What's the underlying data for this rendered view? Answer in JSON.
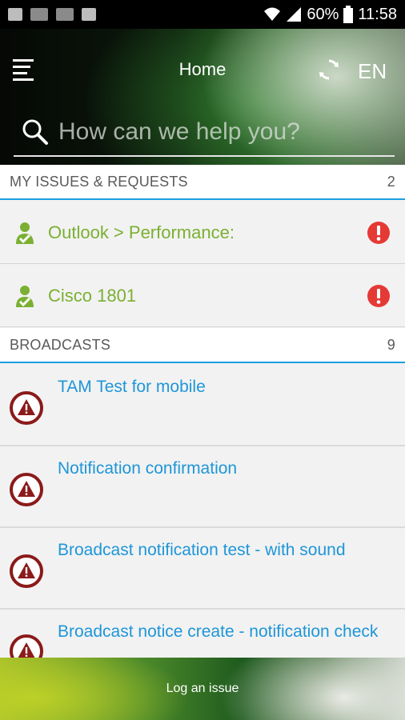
{
  "status_bar": {
    "battery": "60%",
    "time": "11:58"
  },
  "header": {
    "title": "Home",
    "language": "EN",
    "search_placeholder": "How can we help you?"
  },
  "my_issues": {
    "heading": "MY ISSUES & REQUESTS",
    "count": "2",
    "items": [
      {
        "label": "Outlook > Performance:"
      },
      {
        "label": "Cisco 1801"
      }
    ]
  },
  "broadcasts": {
    "heading": "BROADCASTS",
    "count": "9",
    "items": [
      {
        "title": "TAM Test for mobile"
      },
      {
        "title": "Notification confirmation"
      },
      {
        "title": "Broadcast notification test - with sound"
      },
      {
        "title": "Broadcast notice create - notification check"
      }
    ]
  },
  "footer": {
    "label": "Log an issue"
  },
  "colors": {
    "accent_blue": "#1aa0e0",
    "issue_green": "#7bb032",
    "alert_red": "#e53935",
    "broadcast_dark_red": "#8b1a1a"
  }
}
